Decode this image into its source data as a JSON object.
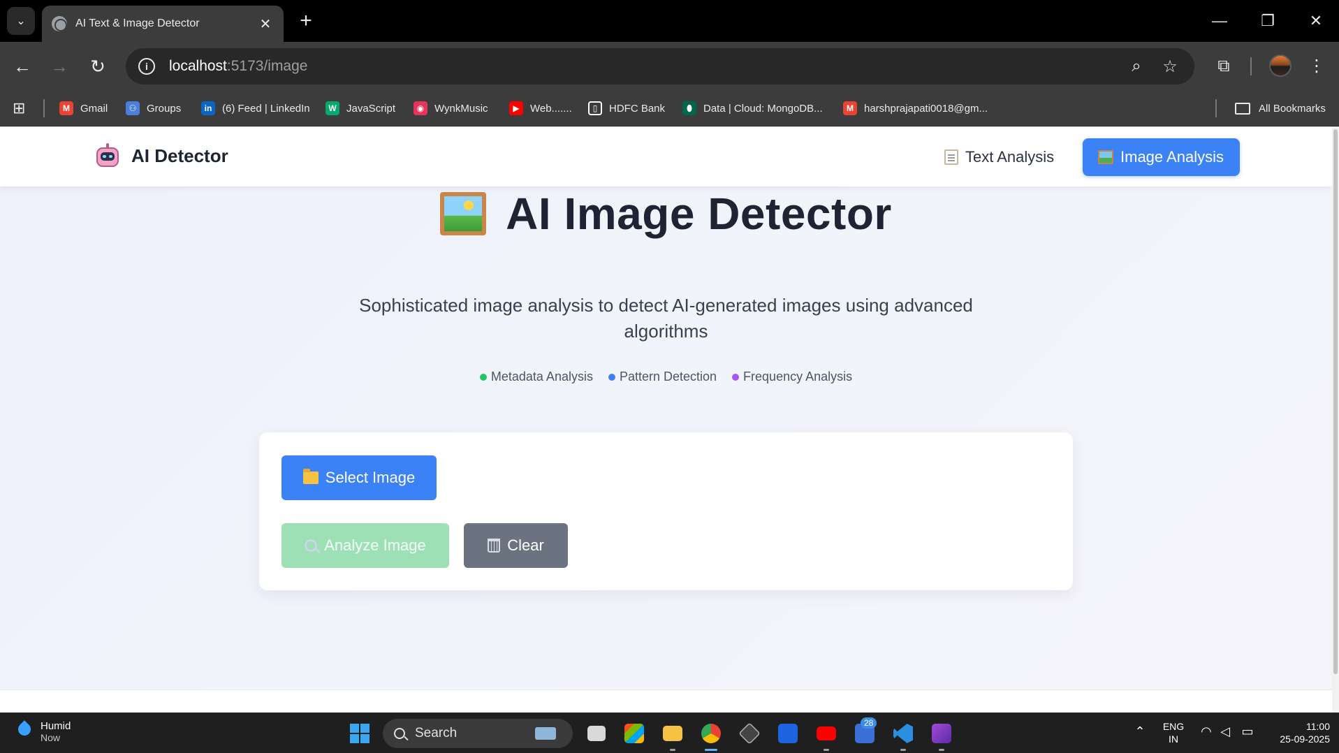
{
  "browser": {
    "tab_title": "AI Text & Image Detector",
    "tab_close": "✕",
    "new_tab": "+",
    "url_host": "localhost",
    "url_path": ":5173/image",
    "window_controls": {
      "minimize": "—",
      "restore": "❐",
      "close": "✕"
    },
    "nav": {
      "back": "←",
      "forward": "→",
      "reload": "↻"
    },
    "toolbar_icons": {
      "zoom": "⌕",
      "bookmark_star": "☆",
      "extensions": "⧉",
      "menu": "⋮"
    },
    "bookmarks": [
      {
        "label": "Gmail",
        "icon": "gmail-icon",
        "color": "#ea4335",
        "glyph": "M"
      },
      {
        "label": "Groups",
        "icon": "groups-icon",
        "color": "#4a7fe0",
        "glyph": "⚇"
      },
      {
        "label": "(6) Feed | LinkedIn",
        "icon": "linkedin-icon",
        "color": "#0a66c2",
        "glyph": "in"
      },
      {
        "label": "JavaScript",
        "icon": "w3schools-icon",
        "color": "#04aa6d",
        "glyph": "W"
      },
      {
        "label": "WynkMusic",
        "icon": "wynk-icon",
        "color": "#e8335a",
        "glyph": "◉"
      },
      {
        "label": "Web.......",
        "icon": "youtube-icon",
        "color": "#ff0000",
        "glyph": "▶"
      },
      {
        "label": "HDFC Bank",
        "icon": "document-icon",
        "color": "#ffffff",
        "glyph": "▯"
      },
      {
        "label": "Data | Cloud: MongoDB...",
        "icon": "mongodb-leaf-icon",
        "color": "#00684a",
        "glyph": "⬮"
      },
      {
        "label": "harshprajapati0018@gm...",
        "icon": "gmail-icon",
        "color": "#ea4335",
        "glyph": "M"
      }
    ],
    "all_bookmarks": "All Bookmarks"
  },
  "app": {
    "brand": "AI Detector",
    "nav_text": "Text Analysis",
    "nav_image": "Image Analysis",
    "accent_color": "#3b82f6"
  },
  "hero": {
    "title": "AI Image Detector",
    "subtitle": "Sophisticated image analysis to detect AI-generated images using advanced algorithms",
    "features": [
      {
        "label": "Metadata Analysis",
        "color": "#22c55e"
      },
      {
        "label": "Pattern Detection",
        "color": "#3b82f6"
      },
      {
        "label": "Frequency Analysis",
        "color": "#a855f7"
      }
    ]
  },
  "card": {
    "select_button": "Select Image",
    "analyze_button": "Analyze Image",
    "clear_button": "Clear"
  },
  "taskbar": {
    "weather_title": "Humid",
    "weather_sub": "Now",
    "search": "Search",
    "notification_badge": "28",
    "lang_line1": "ENG",
    "lang_line2": "IN",
    "time": "11:00",
    "date": "25-09-2025"
  }
}
